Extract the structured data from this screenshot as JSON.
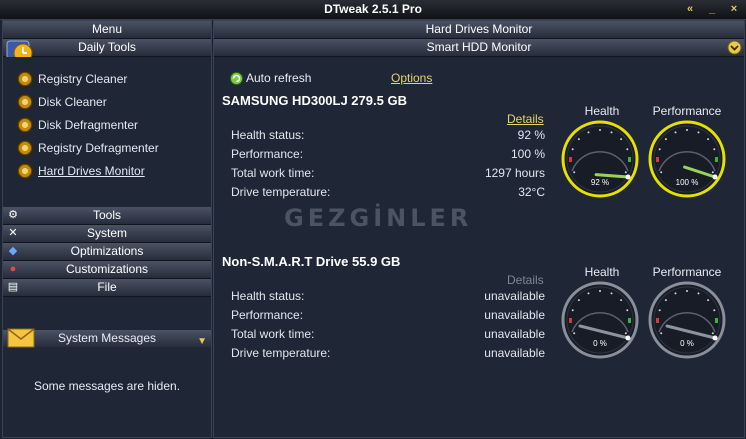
{
  "window": {
    "title": "DTweak 2.5.1 Pro",
    "controls": [
      "«",
      "_",
      "×"
    ]
  },
  "sidebar": {
    "menu_title": "Menu",
    "daily_tools": {
      "title": "Daily Tools",
      "items": [
        {
          "label": "Registry Cleaner",
          "active": false
        },
        {
          "label": "Disk Cleaner",
          "active": false
        },
        {
          "label": "Disk Defragmenter",
          "active": false
        },
        {
          "label": "Registry Defragmenter",
          "active": false
        },
        {
          "label": "Hard Drives Monitor",
          "active": true
        }
      ]
    },
    "sections": [
      {
        "label": "Tools",
        "icon": "gear-icon"
      },
      {
        "label": "System",
        "icon": "wrench-icon"
      },
      {
        "label": "Optimizations",
        "icon": "shield-icon"
      },
      {
        "label": "Customizations",
        "icon": "paint-icon"
      },
      {
        "label": "File",
        "icon": "file-icon"
      }
    ],
    "messages": {
      "title": "System Messages",
      "text": "Some messages are hiden."
    }
  },
  "main": {
    "title": "Hard Drives Monitor",
    "subtitle": "Smart HDD Monitor",
    "auto_refresh_label": "Auto refresh",
    "options_label": "Options",
    "watermark": "GEZGİNLER",
    "drives": [
      {
        "name": "SAMSUNG HD300LJ 279.5 GB",
        "details_label": "Details",
        "details_enabled": true,
        "rows": [
          {
            "key": "Health status:",
            "value": "92 %"
          },
          {
            "key": "Performance:",
            "value": "100 %"
          },
          {
            "key": "Total work time:",
            "value": "1297 hours"
          },
          {
            "key": "Drive temperature:",
            "value": "32°C"
          }
        ],
        "gauges": [
          {
            "label": "Health",
            "text": "92 %",
            "level": 0.92,
            "active": true
          },
          {
            "label": "Performance",
            "text": "100 %",
            "level": 1.0,
            "active": true
          }
        ]
      },
      {
        "name": "Non-S.M.A.R.T Drive 55.9 GB",
        "details_label": "Details",
        "details_enabled": false,
        "rows": [
          {
            "key": "Health status:",
            "value": "unavailable"
          },
          {
            "key": "Performance:",
            "value": "unavailable"
          },
          {
            "key": "Total work time:",
            "value": "unavailable"
          },
          {
            "key": "Drive temperature:",
            "value": "unavailable"
          }
        ],
        "gauges": [
          {
            "label": "Health",
            "text": "0 %",
            "level": 0.0,
            "active": false
          },
          {
            "label": "Performance",
            "text": "0 %",
            "level": 0.0,
            "active": false
          }
        ]
      }
    ]
  },
  "colors": {
    "accent": "#e7c94e",
    "link": "#e7d36a",
    "gauge_ring_active": "#e6e000",
    "gauge_ring_inactive": "#8a8f99",
    "needle_active": "#9ad158"
  }
}
